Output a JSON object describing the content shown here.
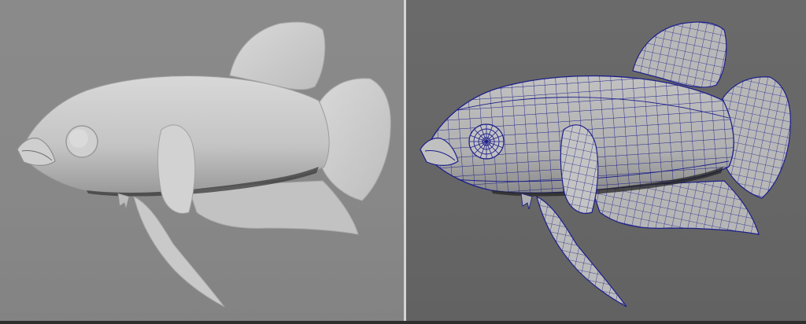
{
  "app": {
    "title": ""
  },
  "viewports": [
    {
      "id": "left",
      "shading": "smooth-shaded"
    },
    {
      "id": "right",
      "shading": "wireframe-on-shaded"
    }
  ],
  "colors": {
    "left_background": "#878787",
    "right_background": "#666666",
    "model_fill_left": "#c6c6c6",
    "model_fill_right": "#b4b4b4",
    "wireframe": "#1d1f8a",
    "divider": "#d4d4d4"
  },
  "model": {
    "subject": "betta-fish"
  }
}
